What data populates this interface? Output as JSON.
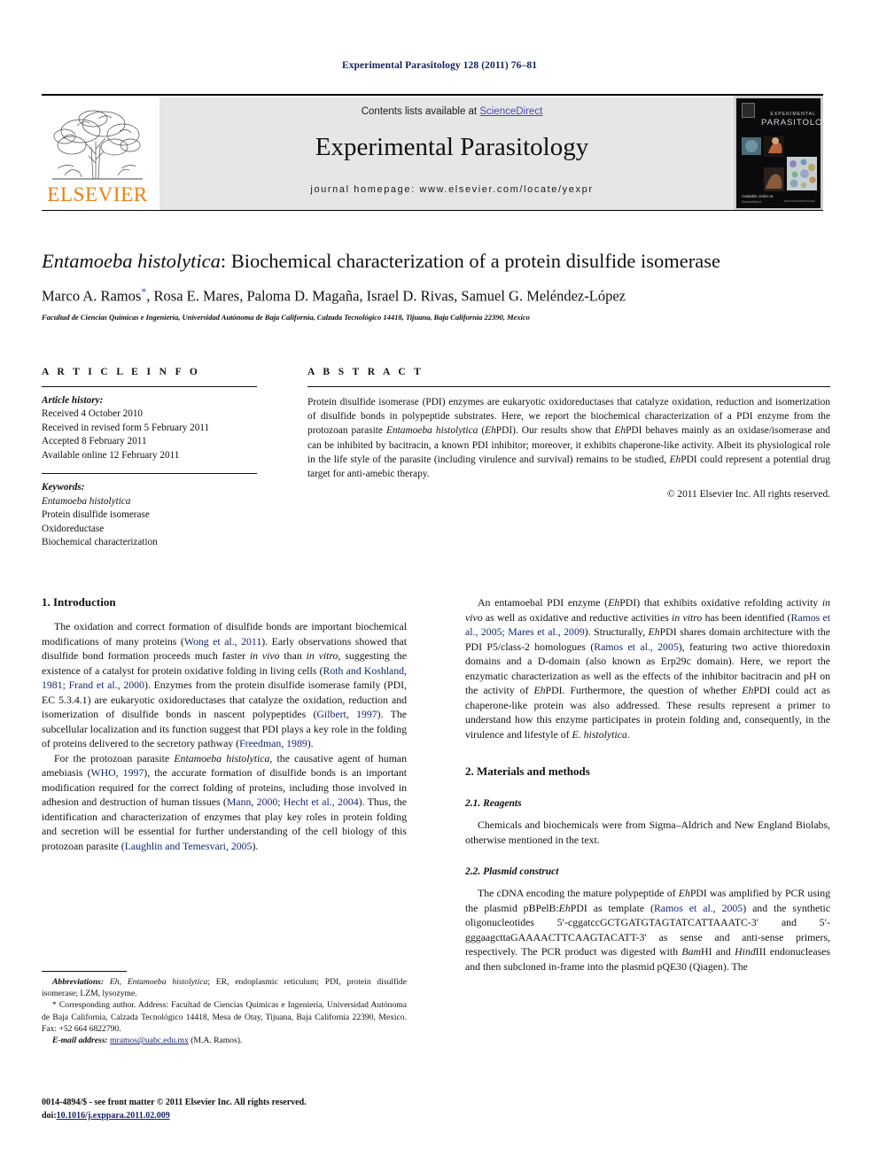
{
  "running_head": "Experimental Parasitology 128 (2011) 76–81",
  "journal_header": {
    "contents_prefix": "Contents lists available at ",
    "sciencedirect_link": "ScienceDirect",
    "journal_title": "Experimental Parasitology",
    "homepage_line": "journal homepage: www.elsevier.com/locate/yexpr",
    "publisher_wordmark": "ELSEVIER",
    "publisher_color": "#f07f12",
    "link_color": "#4a48b5",
    "band_color": "#e6e6e6",
    "cover": {
      "line1": "EXPERIMENTAL",
      "line2": "PARASITOLOGY",
      "sciencedirect_mark": "ScienceDirect",
      "availability": "Available online at",
      "url": "www.sciencedirect.com"
    }
  },
  "article": {
    "title_italic_part": "Entamoeba histolytica",
    "title_rest": ": Biochemical characterization of a protein disulfide isomerase",
    "authors": "Marco A. Ramos",
    "corresponding_marker": "*",
    "authors_rest": ", Rosa E. Mares, Paloma D. Magaña, Israel D. Rivas, Samuel G. Meléndez-López",
    "affiliation": "Facultad de Ciencias Químicas e Ingeniería, Universidad Autónoma de Baja California, Calzada Tecnológico 14418, Tijuana, Baja California 22390, Mexico"
  },
  "article_info": {
    "heading": "A R T I C L E   I N F O",
    "history_label": "Article history:",
    "history": [
      "Received 4 October 2010",
      "Received in revised form 5 February 2011",
      "Accepted 8 February 2011",
      "Available online 12 February 2011"
    ],
    "keywords_label": "Keywords:",
    "keyword_italic": "Entamoeba histolytica",
    "keywords": [
      "Protein disulfide isomerase",
      "Oxidoreductase",
      "Biochemical characterization"
    ]
  },
  "abstract": {
    "heading": "A B S T R A C T",
    "p1_a": "Protein disulfide isomerase (PDI) enzymes are eukaryotic oxidoreductases that catalyze oxidation, reduction and isomerization of disulfide bonds in polypeptide substrates. Here, we report the biochemical characterization of a PDI enzyme from the protozoan parasite ",
    "p1_italic1": "Entamoeba histolytica",
    "p1_b": " (",
    "p1_italic2": "Eh",
    "p1_c": "PDI). Our results show that ",
    "p1_italic3": "Eh",
    "p1_d": "PDI behaves mainly as an oxidase/isomerase and can be inhibited by bacitracin, a known PDI inhibitor; moreover, it exhibits chaperone-like activity. Albeit its physiological role in the life style of the parasite (including virulence and survival) remains to be studied, ",
    "p1_italic4": "Eh",
    "p1_e": "PDI could represent a potential drug target for anti-amebic therapy.",
    "copyright": "© 2011 Elsevier Inc. All rights reserved."
  },
  "body": {
    "section1_heading": "1. Introduction",
    "section2_heading": "2. Materials and methods",
    "subsection21_heading": "2.1. Reagents",
    "subsection22_heading": "2.2. Plasmid construct",
    "intro_p1": {
      "t1": "The oxidation and correct formation of disulfide bonds are important biochemical modifications of many proteins (",
      "r1": "Wong et al., 2011",
      "t2": "). Early observations showed that disulfide bond formation proceeds much faster ",
      "i1": "in vivo",
      "t3": " than ",
      "i2": "in vitro",
      "t4": ", suggesting the existence of a catalyst for protein oxidative folding in living cells (",
      "r2": "Roth and Koshland, 1981; Frand et al., 2000",
      "t5": "). Enzymes from the protein disulfide isomerase family (PDI, EC 5.3.4.1) are eukaryotic oxidoreductases that catalyze the oxidation, reduction and isomerization of disulfide bonds in nascent polypeptides (",
      "r3": "Gilbert, 1997",
      "t6": "). The subcellular localization and its function suggest that PDI plays a key role in the folding of proteins delivered to the secretory pathway (",
      "r4": "Freedman, 1989",
      "t7": ")."
    },
    "intro_p2": {
      "t1": "For the protozoan parasite ",
      "i1": "Entamoeba histolytica",
      "t2": ", the causative agent of human amebiasis (",
      "r1": "WHO, 1997",
      "t3": "), the accurate formation of disulfide bonds is an important modification required for the correct folding of proteins, including those involved in adhesion and destruction of human tissues (",
      "r2": "Mann, 2000; Hecht et al., 2004",
      "t4": "). Thus, the identification and characterization of enzymes that play key roles in protein folding and secretion will be essential for further understanding of the cell biology of this protozoan parasite (",
      "r3": "Laughlin and Temesvari, 2005",
      "t5": ")."
    },
    "intro_p3": {
      "t1": "An entamoebal PDI enzyme (",
      "i1": "Eh",
      "t2": "PDI) that exhibits oxidative refolding activity ",
      "i2": "in vivo",
      "t3": " as well as oxidative and reductive activities ",
      "i3": "in vitro",
      "t4": " has been identified (",
      "r1": "Ramos et al., 2005; Mares et al., 2009",
      "t5": "). Structurally, ",
      "i4": "Eh",
      "t6": "PDI shares domain architecture with the PDI P5/class-2 homologues (",
      "r2": "Ramos et al., 2005",
      "t7": "), featuring two active thioredoxin domains and a D-domain (also known as Erp29c domain). Here, we report the enzymatic characterization as well as the effects of the inhibitor bacitracin and pH on the activity of ",
      "i5": "Eh",
      "t8": "PDI. Furthermore, the question of whether ",
      "i6": "Eh",
      "t9": "PDI could act as chaperone-like protein was also addressed. These results represent a primer to understand how this enzyme participates in protein folding and, consequently, in the virulence and lifestyle of ",
      "i7": "E. histolytica",
      "t10": "."
    },
    "reagents_p": "Chemicals and biochemicals were from Sigma–Aldrich and New England Biolabs, otherwise mentioned in the text.",
    "plasmid_p": {
      "t1": "The cDNA encoding the mature polypeptide of ",
      "i1": "Eh",
      "t2": "PDI was amplified by PCR using the plasmid pBPelB:",
      "i2": "Eh",
      "t3": "PDI as template (",
      "r1": "Ramos et al., 2005",
      "t4": ") and the synthetic oligonucleotides 5′-cggatccGCTGATGTAGTATCATTAAATC-3′ and 5′-gggaagcttaGAAAACTTCAAGTACATT-3′ as sense and anti-sense primers, respectively. The PCR product was digested with ",
      "i3": "Bam",
      "t5": "HI and ",
      "i4": "Hind",
      "t6": "III endonucleases and then subcloned in-frame into the plasmid pQE30 (Qiagen). The"
    }
  },
  "footnotes": {
    "abbrev_label": "Abbreviations:",
    "abbrev_i1": "Eh",
    "abbrev_t1": ", ",
    "abbrev_i2": "Entamoeba histolytica",
    "abbrev_t2": "; ER, endoplasmic reticulum; PDI, protein disulfide isomerase; LZM, lysozyme.",
    "corresponding": "* Corresponding author. Address: Facultad de Ciencias Químicas e Ingeniería, Universidad Autónoma de Baja California, Calzada Tecnológico 14418, Mesa de Otay, Tijuana, Baja California 22390, Mexico. Fax: +52 664 6822790.",
    "email_label": "E-mail address:",
    "email": "mramos@uabc.edu.mx",
    "email_suffix": "(M.A. Ramos)."
  },
  "bottom_matter": {
    "issn_line": "0014-4894/$ - see front matter © 2011 Elsevier Inc. All rights reserved.",
    "doi_label": "doi:",
    "doi_value": "10.1016/j.exppara.2011.02.009"
  }
}
